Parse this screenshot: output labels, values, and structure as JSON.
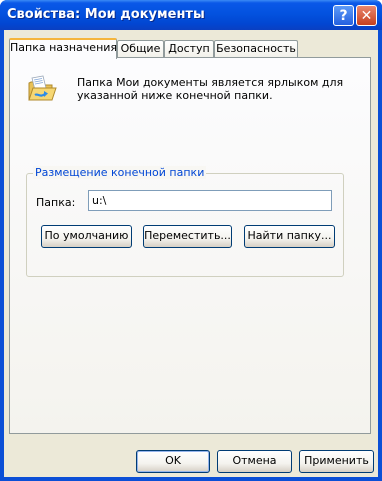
{
  "window": {
    "title": "Свойства: Мои документы"
  },
  "titlebar_buttons": {
    "help": "?",
    "close": "✕"
  },
  "tabs": [
    {
      "label": "Папка назначения",
      "active": true
    },
    {
      "label": "Общие",
      "active": false
    },
    {
      "label": "Доступ",
      "active": false
    },
    {
      "label": "Безопасность",
      "active": false
    }
  ],
  "content": {
    "description": "Папка Мои документы является ярлыком для указанной ниже конечной папки.",
    "group_title": "Размещение конечной папки",
    "field_label": "Папка:",
    "field_value": "u:\\",
    "buttons": {
      "default": "По умолчанию",
      "move": "Переместить...",
      "find": "Найти папку..."
    }
  },
  "footer": {
    "ok": "OK",
    "cancel": "Отмена",
    "apply": "Применить"
  },
  "colors": {
    "title_blue": "#0352df",
    "group_title": "#0046d5",
    "face": "#ece9d8"
  },
  "icons": [
    "help-icon",
    "close-icon",
    "folder-icon"
  ]
}
